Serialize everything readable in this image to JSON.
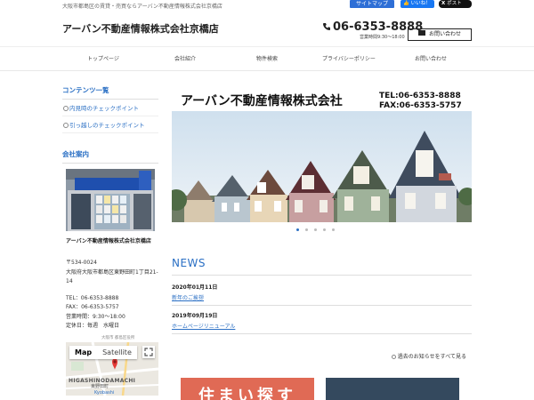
{
  "topbar": {
    "tagline": "大阪市都島区の賃貸・売買ならアーバン不動産情報株式会社京橋店",
    "sitemap": "サイトマップ",
    "like": "いいね！",
    "post": "ポスト"
  },
  "header": {
    "site_title": "アーバン不動産情報株式会社京橋店",
    "phone": "06-6353-8888",
    "hours": "営業時間9:30～18:00",
    "contact": "お問い合わせ"
  },
  "nav": {
    "items": [
      {
        "label": "トップページ"
      },
      {
        "label": "会社紹介"
      },
      {
        "label": "物件検索"
      },
      {
        "label": "プライバシーポリシー"
      },
      {
        "label": "お問い合わせ"
      }
    ]
  },
  "sidebar": {
    "contents_heading": "コンテンツ一覧",
    "links": [
      {
        "label": "内見時のチェックポイント"
      },
      {
        "label": "引っ越しのチェックポイント"
      }
    ],
    "company_heading": "会社案内",
    "office_name": "アーバン不動産情報株式会社京橋店",
    "postal": "〒534-0024",
    "address": "大阪府大阪市都島区東野田町1丁目21-14",
    "tel": "TEL：06-6353-8888",
    "fax": "FAX：06-6353-5757",
    "hours": "営業時間：9:30～18:00",
    "holiday": "定休日：毎週　水曜日",
    "map_label": "大阪市 都島区役所",
    "map_tab_map": "Map",
    "map_tab_satellite": "Satellite",
    "map_place": "HIGASHINODAMACHI",
    "map_place_jp": "東野田町",
    "map_station": "Kyobashi"
  },
  "banner": {
    "company": "アーバン不動産情報株式会社",
    "tel": "TEL:06-6353-8888",
    "fax": "FAX:06-6353-5757",
    "slides": 5,
    "active_slide": 1
  },
  "news": {
    "heading": "NEWS",
    "items": [
      {
        "date": "2020年01月11日",
        "title": "新年のご挨拶"
      },
      {
        "date": "2019年09月19日",
        "title": "ホームページリニューアル"
      }
    ],
    "more": "過去のお知らせをすべて見る"
  },
  "cta": {
    "left_text": "住まい探す"
  },
  "colors": {
    "link_blue": "#2a6fc4",
    "cta_red": "#e06a55",
    "cta_navy": "#34495e"
  }
}
